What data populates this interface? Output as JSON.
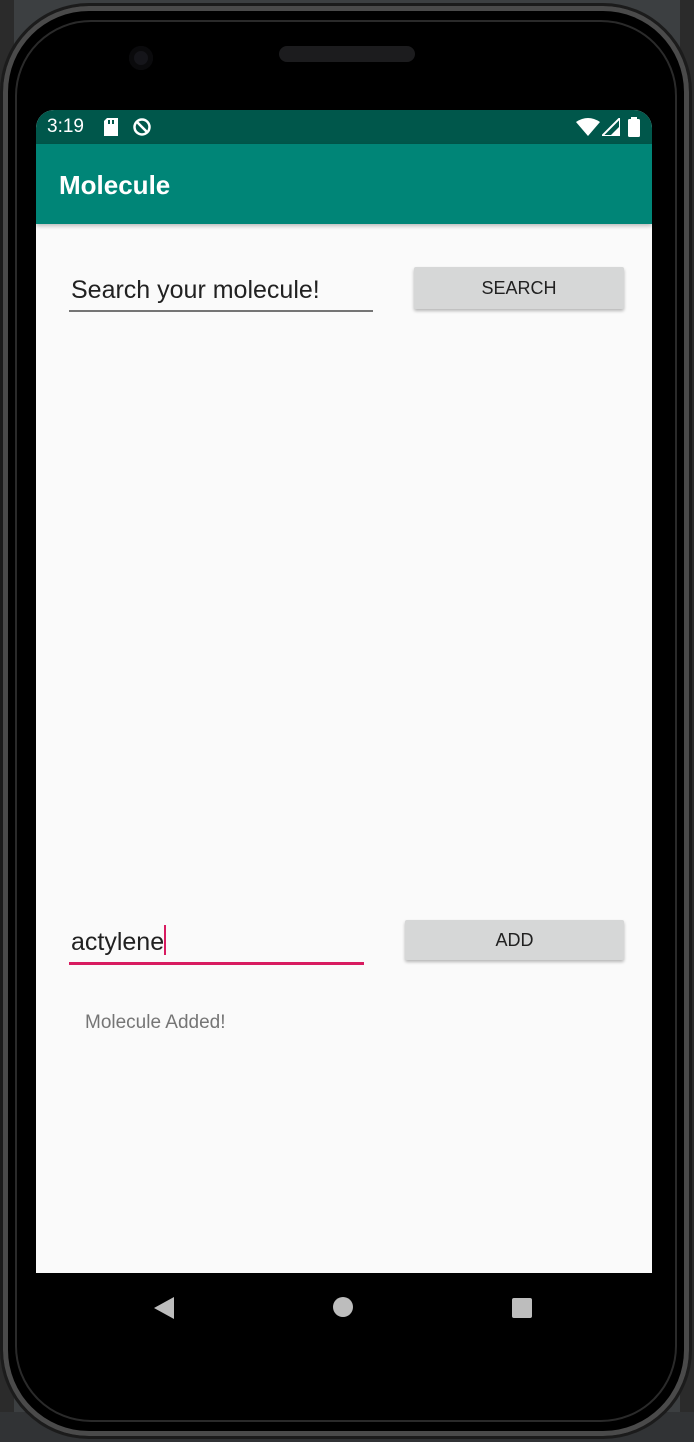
{
  "status_bar": {
    "time": "3:19"
  },
  "app_bar": {
    "title": "Molecule"
  },
  "search": {
    "placeholder": "Search your molecule!",
    "button_label": "SEARCH"
  },
  "add": {
    "value": "actylene",
    "button_label": "ADD"
  },
  "status_message": "Molecule Added!",
  "colors": {
    "primary": "#008577",
    "primary_dark": "#00574b",
    "accent": "#d81b60"
  },
  "nav_icons": [
    "back-icon",
    "home-icon",
    "recents-icon"
  ]
}
